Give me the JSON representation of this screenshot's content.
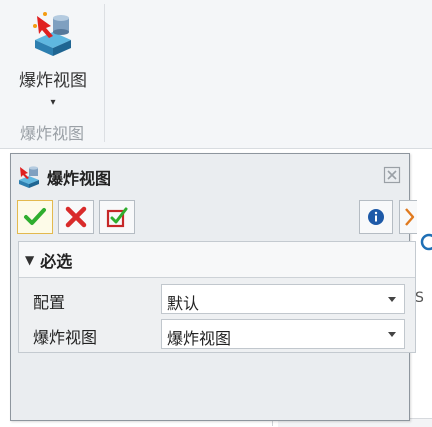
{
  "ribbon": {
    "explode_button_label": "爆炸视图",
    "group_label": "爆炸视图",
    "dropdown_glyph": "▾"
  },
  "dialog": {
    "title": "爆炸视图",
    "title_icon": "explode-view-icon",
    "close_glyph": "⊠",
    "toolbar": {
      "ok_icon": "checkmark-icon",
      "cancel_icon": "x-icon",
      "apply_icon": "apply-check-icon",
      "info_icon": "info-icon",
      "expand_icon": "chevron-right-icon"
    },
    "section": {
      "collapse_glyph": "▼",
      "title": "必选",
      "fields": [
        {
          "label": "配置",
          "value": "默认"
        },
        {
          "label": "爆炸视图",
          "value": "爆炸视图"
        }
      ]
    }
  },
  "colors": {
    "ok_green": "#2fae2f",
    "cancel_red": "#d92b2b",
    "apply_red": "#c62828",
    "info_blue": "#1e5aa8",
    "expand_orange": "#e07a1f",
    "dialog_bg": "#eaedf0"
  }
}
